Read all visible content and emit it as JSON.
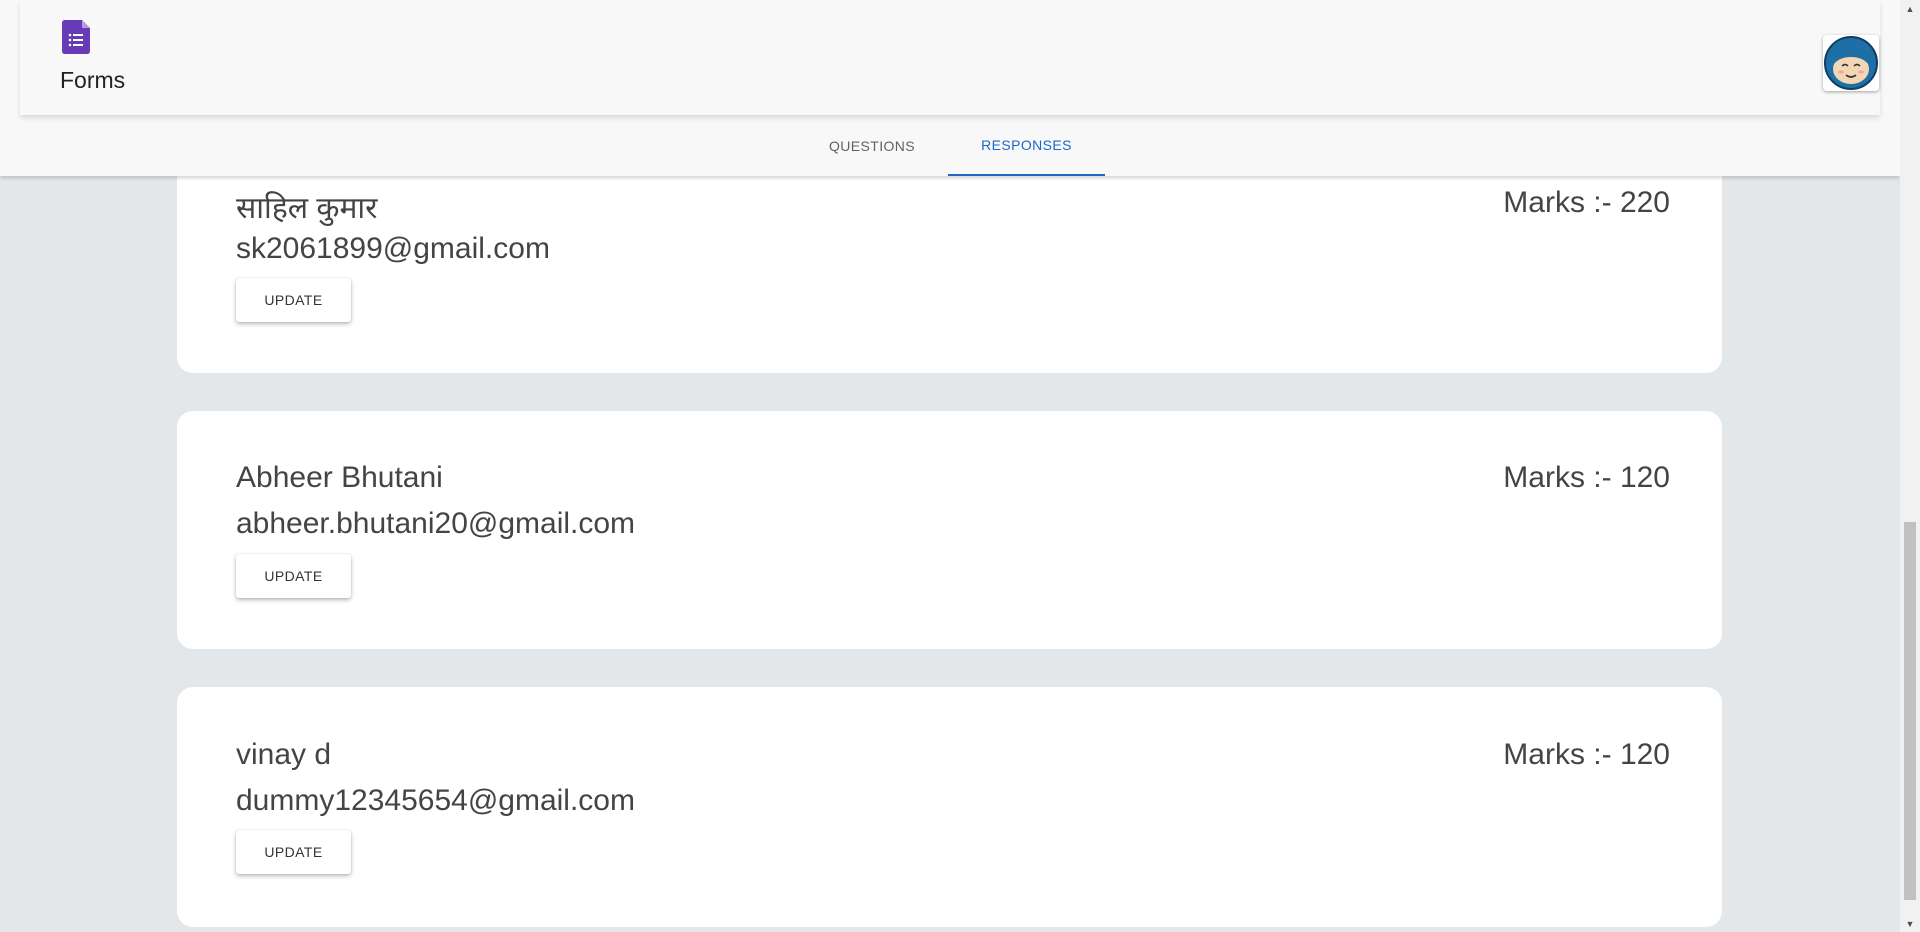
{
  "app": {
    "title": "Forms",
    "logo_icon": "forms-logo-icon",
    "brand_color": "#673ab7"
  },
  "tabs": [
    {
      "label": "QUESTIONS",
      "active": false
    },
    {
      "label": "RESPONSES",
      "active": true
    }
  ],
  "accent_color": "#1a67c8",
  "responses": [
    {
      "name": "साहिल कुमार",
      "email": "sk2061899@gmail.com",
      "marks": "Marks :- 220",
      "button": "UPDATE"
    },
    {
      "name": "Abheer Bhutani",
      "email": "abheer.bhutani20@gmail.com",
      "marks": "Marks :- 120",
      "button": "UPDATE"
    },
    {
      "name": "vinay d",
      "email": "dummy12345654@gmail.com",
      "marks": "Marks :- 120",
      "button": "UPDATE"
    }
  ],
  "scrollbar": {
    "position_fraction": 0.82
  }
}
